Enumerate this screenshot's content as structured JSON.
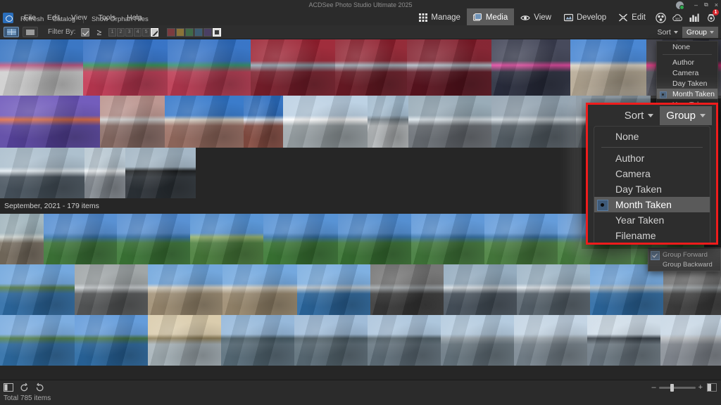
{
  "window": {
    "title": "ACDSee Photo Studio Ultimate 2025",
    "minimize": "–",
    "maximize": "❐",
    "close": "×"
  },
  "menubar": {
    "items": [
      "File",
      "Edit",
      "View",
      "Tools",
      "Help"
    ],
    "secondary": [
      "Refresh",
      "Catalog",
      "Show Orphan Files"
    ]
  },
  "modes": {
    "tabs": [
      {
        "label": "Manage",
        "icon": "grid-icon",
        "active": false
      },
      {
        "label": "Media",
        "icon": "media-icon",
        "active": true
      },
      {
        "label": "View",
        "icon": "eye-icon",
        "active": false
      },
      {
        "label": "Develop",
        "icon": "develop-icon",
        "active": false
      },
      {
        "label": "Edit",
        "icon": "edit-icon",
        "active": false
      }
    ],
    "icons": [
      {
        "name": "people-icon",
        "badge": ""
      },
      {
        "name": "cloud-365-icon",
        "badge": ""
      },
      {
        "name": "chart-icon",
        "badge": ""
      },
      {
        "name": "notifications-icon",
        "badge": "1"
      }
    ]
  },
  "filterbar": {
    "view_modes": [
      "thumbnail-grid-view",
      "filmstrip-view"
    ],
    "filter_label": "Filter By:",
    "operator": "≥",
    "ratings": [
      "1",
      "2",
      "3",
      "4",
      "5"
    ],
    "no_rating_label": "no-rating",
    "color_labels": [
      "#7a3b3f",
      "#8a7338",
      "#3f6a48",
      "#3c5c73",
      "#4a3f63"
    ],
    "no_color_label": "no-label"
  },
  "sort_group": {
    "sort_label": "Sort",
    "group_label": "Group"
  },
  "group_menu": {
    "items": [
      {
        "label": "None",
        "selected": false,
        "divider_after": true
      },
      {
        "label": "Author",
        "selected": false
      },
      {
        "label": "Camera",
        "selected": false
      },
      {
        "label": "Day Taken",
        "selected": false
      },
      {
        "label": "Month Taken",
        "selected": true
      },
      {
        "label": "Year Taken",
        "selected": false
      },
      {
        "label": "Filename",
        "selected": false
      }
    ]
  },
  "context_menu": {
    "items": [
      {
        "label": "Group Forward",
        "checked": true
      },
      {
        "label": "Group Backward",
        "checked": false
      }
    ]
  },
  "group_header": {
    "label": "September, 2021 - 179 items"
  },
  "statusbar": {
    "total": "Total 785 items",
    "tools": [
      "panel-toggle-icon",
      "rotate-left-icon",
      "rotate-right-icon"
    ],
    "zoom_minus": "–",
    "zoom_plus": "+"
  },
  "accent": {
    "callout_border": "#ee1c1c",
    "active_tab_bg": "#5b5b5b",
    "selection_bg": "#5a5a5a",
    "badge_red": "#d7262c"
  },
  "thumbnails": {
    "section_top": [
      [
        {
          "w": 118,
          "h": 80,
          "sky": "#2f6fc0",
          "ground": "#cfcfcf",
          "accent": "#b8507e",
          "kind": "building-white"
        },
        {
          "w": 120,
          "h": 80,
          "sky": "#2d6cc2",
          "ground": "#c43a55",
          "accent": "#2f8f52",
          "kind": "palm-stripes"
        },
        {
          "w": 118,
          "h": 80,
          "sky": "#2e6ec4",
          "ground": "#bb3a52",
          "accent": "#2e8d6a",
          "kind": "palm-stripes2"
        },
        {
          "w": 120,
          "h": 80,
          "sky": "#9a2030",
          "ground": "#7d1f2c",
          "accent": "#8fa6b2",
          "kind": "red-gallery"
        },
        {
          "w": 102,
          "h": 80,
          "sky": "#8e1f2d",
          "ground": "#6e1b26",
          "accent": "#9fb0bb",
          "kind": "red-gallery2"
        },
        {
          "w": 120,
          "h": 80,
          "sky": "#7f1a28",
          "ground": "#5e1420",
          "accent": "#aab9c4",
          "kind": "red-gallery3"
        },
        {
          "w": 112,
          "h": 80,
          "sky": "#3c3f52",
          "ground": "#2b2f40",
          "accent": "#e0429c",
          "kind": "olympia"
        },
        {
          "w": 108,
          "h": 80,
          "sky": "#3f80d0",
          "ground": "#b5a893",
          "accent": "#d8cfc0",
          "kind": "stone-building"
        },
        {
          "w": 106,
          "h": 80,
          "sky": "#2e2f3a",
          "ground": "#4a4b55",
          "accent": "#d21f6e",
          "kind": "street-pink"
        }
      ],
      [
        {
          "w": 142,
          "h": 74,
          "sky": "#6a53b8",
          "ground": "#5b46a4",
          "accent": "#e0683f",
          "kind": "keys"
        },
        {
          "w": 92,
          "h": 74,
          "sky": "#b8908a",
          "ground": "#8d6f68",
          "accent": "#cfcfcf",
          "kind": "stairs"
        },
        {
          "w": 112,
          "h": 74,
          "sky": "#2f74c8",
          "ground": "#9b6f63",
          "accent": "#d8d2c6",
          "kind": "wall-sky"
        },
        {
          "w": 56,
          "h": 74,
          "sky": "#2a6cbe",
          "ground": "#8a4f44",
          "accent": "#d9e6f2",
          "kind": "brick"
        },
        {
          "w": 120,
          "h": 74,
          "sky": "#b9cfe2",
          "ground": "#9fa8ac",
          "accent": "#ffffff",
          "kind": "modern-building"
        },
        {
          "w": 58,
          "h": 74,
          "sky": "#9fb8cc",
          "ground": "#b9bdbf",
          "accent": "#6e7a82",
          "kind": "railing"
        },
        {
          "w": 118,
          "h": 74,
          "sky": "#93a7b4",
          "ground": "#6c7177",
          "accent": "#d9e2e8",
          "kind": "beach-bw"
        },
        {
          "w": 120,
          "h": 74,
          "sky": "#8e9fad",
          "ground": "#59636b",
          "accent": "#cfd8de",
          "kind": "fort-sea"
        },
        {
          "w": 106,
          "h": 74,
          "sky": "#7d8e9c",
          "ground": "#4e575e",
          "accent": "#e4ebf0",
          "kind": "sun-sea"
        }
      ],
      [
        {
          "w": 120,
          "h": 72,
          "sky": "#a8bccb",
          "ground": "#4a5661",
          "accent": "#e3ecf2",
          "kind": "pier-sea"
        },
        {
          "w": 58,
          "h": 72,
          "sky": "#b5c5d0",
          "ground": "#8a9198",
          "accent": "#f0f4f7",
          "kind": "beach-wide"
        },
        {
          "w": 100,
          "h": 72,
          "sky": "#9fb3c2",
          "ground": "#2e343a",
          "accent": "#141719",
          "kind": "bench-silhouette"
        }
      ]
    ],
    "section_bottom": [
      [
        {
          "w": 62,
          "h": 72,
          "sky": "#9db2ba",
          "ground": "#7a7062",
          "accent": "#cfd6d2",
          "kind": "rock-house"
        },
        {
          "w": 104,
          "h": 72,
          "sky": "#4f8ad0",
          "ground": "#3f7a3a",
          "accent": "#2f6fa8",
          "kind": "coast-green"
        },
        {
          "w": 104,
          "h": 72,
          "sky": "#4f8ad0",
          "ground": "#3d7a38",
          "accent": "#2e6ea6",
          "kind": "coast-green2"
        },
        {
          "w": 104,
          "h": 72,
          "sky": "#5190d4",
          "ground": "#4a7f3c",
          "accent": "#8fae6a",
          "kind": "coast-path"
        },
        {
          "w": 106,
          "h": 72,
          "sky": "#4e8cd2",
          "ground": "#3c7a36",
          "accent": "#2d6da4",
          "kind": "coast-green3"
        },
        {
          "w": 104,
          "h": 72,
          "sky": "#4a88ce",
          "ground": "#3a7534",
          "accent": "#2b6aa0",
          "kind": "coast-green4"
        },
        {
          "w": 104,
          "h": 72,
          "sky": "#5793d6",
          "ground": "#437c3c",
          "accent": "#2f6fa8",
          "kind": "coast-island"
        },
        {
          "w": 104,
          "h": 72,
          "sky": "#5b96d8",
          "ground": "#4a8140",
          "accent": "#326fa6",
          "kind": "coast-island2"
        },
        {
          "w": 104,
          "h": 72,
          "sky": "#5a95d7",
          "ground": "#47803e",
          "accent": "#316ea5",
          "kind": "coast-island3"
        },
        {
          "w": 104,
          "h": 72,
          "sky": "#5794d6",
          "ground": "#45803d",
          "accent": "#2f6da4",
          "kind": "coast-island4"
        }
      ],
      [
        {
          "w": 106,
          "h": 72,
          "sky": "#6ba3dc",
          "ground": "#2f6ea8",
          "accent": "#4f7a44",
          "kind": "headland"
        },
        {
          "w": 104,
          "h": 72,
          "sky": "#9aa0a2",
          "ground": "#595b5c",
          "accent": "#c8cdd0",
          "kind": "dark-sand"
        },
        {
          "w": 106,
          "h": 72,
          "sky": "#6aa2db",
          "ground": "#a08f74",
          "accent": "#d8d2c4",
          "kind": "tower-beach"
        },
        {
          "w": 106,
          "h": 72,
          "sky": "#6ba3dc",
          "ground": "#9d8c71",
          "accent": "#d4cec0",
          "kind": "tower-beach2"
        },
        {
          "w": 104,
          "h": 72,
          "sky": "#77abdf",
          "ground": "#2d6ba4",
          "accent": "#bdc9d2",
          "kind": "sea-horizon"
        },
        {
          "w": 104,
          "h": 72,
          "sky": "#6f6f6f",
          "ground": "#3a3a3a",
          "accent": "#9aa0a4",
          "kind": "jetty-dark"
        },
        {
          "w": 104,
          "h": 72,
          "sky": "#8ea7bb",
          "ground": "#4a5560",
          "accent": "#d0d8de",
          "kind": "pier-struct"
        },
        {
          "w": 104,
          "h": 72,
          "sky": "#9ab2c4",
          "ground": "#5a6670",
          "accent": "#dde4ea",
          "kind": "pier-struct2"
        },
        {
          "w": 104,
          "h": 72,
          "sky": "#6fa5dc",
          "ground": "#2e6ca5",
          "accent": "#a8b8c4",
          "kind": "coast-bay"
        },
        {
          "w": 104,
          "h": 72,
          "sky": "#6b6b6b",
          "ground": "#404040",
          "accent": "#8f9598",
          "kind": "shadow-wall"
        }
      ],
      [
        {
          "w": 106,
          "h": 72,
          "sky": "#74a8de",
          "ground": "#2f6fa8",
          "accent": "#4a7c42",
          "kind": "boat-bay"
        },
        {
          "w": 104,
          "h": 72,
          "sky": "#5b96d8",
          "ground": "#2a6aa4",
          "accent": "#3f7340",
          "kind": "boat-bay2"
        },
        {
          "w": 104,
          "h": 72,
          "sky": "#d8c9a8",
          "ground": "#a8b4ba",
          "accent": "#8a7a52",
          "kind": "boat-sunset"
        },
        {
          "w": 104,
          "h": 72,
          "sky": "#8fb4d8",
          "ground": "#5a6f7c",
          "accent": "#3f5560",
          "kind": "harbour"
        },
        {
          "w": 104,
          "h": 72,
          "sky": "#9ab8d6",
          "ground": "#5d6f7a",
          "accent": "#44565f",
          "kind": "harbour2"
        },
        {
          "w": 104,
          "h": 72,
          "sky": "#a8c2da",
          "ground": "#63737e",
          "accent": "#4a5b64",
          "kind": "harbour3"
        },
        {
          "w": 104,
          "h": 72,
          "sky": "#b0c8dd",
          "ground": "#6a7983",
          "accent": "#8d99a1",
          "kind": "town-quay"
        },
        {
          "w": 104,
          "h": 72,
          "sky": "#c0d2e2",
          "ground": "#7b8892",
          "accent": "#9aa5ad",
          "kind": "town-quay2"
        },
        {
          "w": 104,
          "h": 72,
          "sky": "#cddbe7",
          "ground": "#6e7b85",
          "accent": "#2f3840",
          "kind": "tree-silhouette"
        },
        {
          "w": 104,
          "h": 72,
          "sky": "#c6d6e4",
          "ground": "#8a9098",
          "accent": "#b8bcc0",
          "kind": "building-quay"
        }
      ]
    ]
  }
}
